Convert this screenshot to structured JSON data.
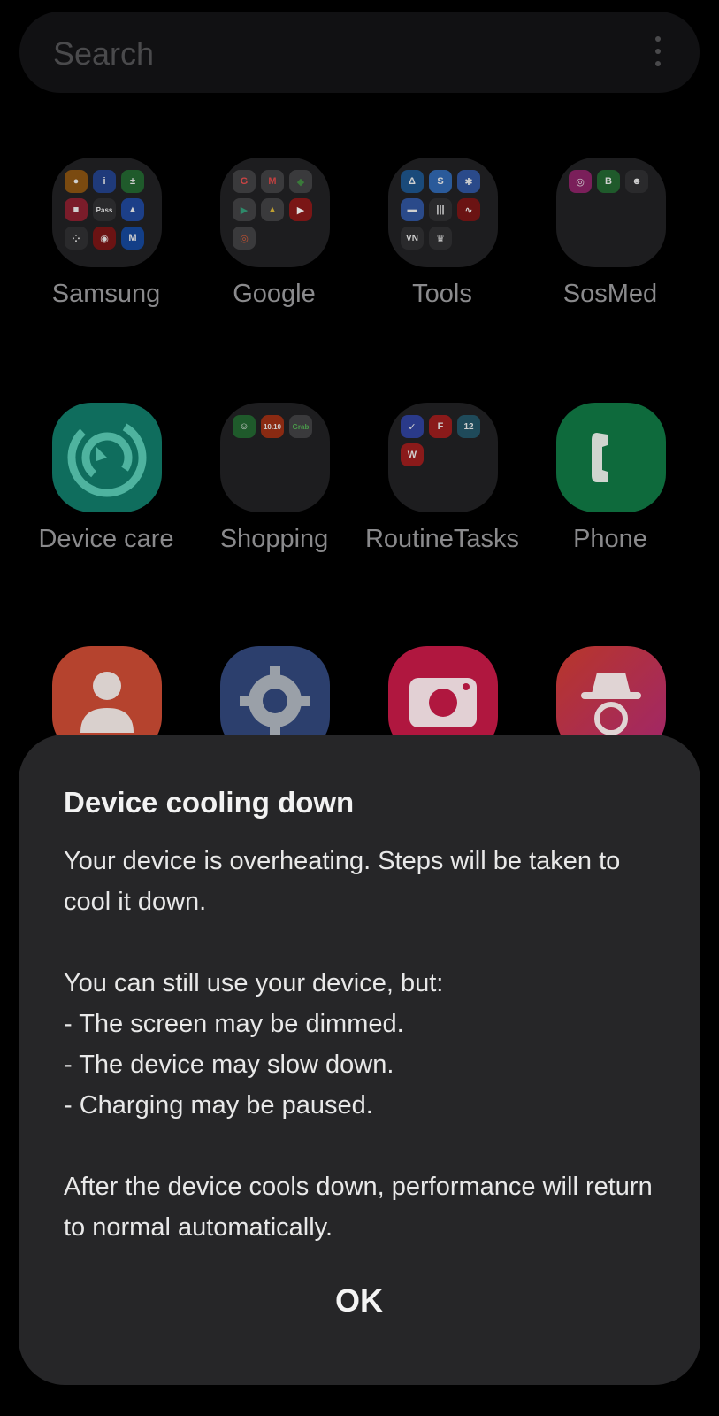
{
  "search": {
    "placeholder": "Search",
    "menu_icon": "more-vertical-icon"
  },
  "apps": [
    {
      "label": "Samsung",
      "type": "folder"
    },
    {
      "label": "Google",
      "type": "folder"
    },
    {
      "label": "Tools",
      "type": "folder"
    },
    {
      "label": "SosMed",
      "type": "folder"
    },
    {
      "label": "Device care",
      "type": "app",
      "icon": "device-care-icon"
    },
    {
      "label": "Shopping",
      "type": "folder"
    },
    {
      "label": "RoutineTasks",
      "type": "folder"
    },
    {
      "label": "Phone",
      "type": "app",
      "icon": "phone-icon"
    },
    {
      "label": "",
      "type": "app",
      "icon": "contacts-icon"
    },
    {
      "label": "",
      "type": "app",
      "icon": "settings-icon"
    },
    {
      "label": "",
      "type": "app",
      "icon": "camera-icon"
    },
    {
      "label": "",
      "type": "app",
      "icon": "incognito-icon"
    }
  ],
  "folder_labels": {
    "pass": "Pass",
    "vn": "VN",
    "date_1010": "10.10",
    "grab": "Grab",
    "cal_12": "12"
  },
  "dialog": {
    "title": "Device cooling down",
    "line1": "Your device is overheating. Steps will be taken to cool it down.",
    "line2": "You can still use your device, but:",
    "bullet1": "- The screen may be dimmed.",
    "bullet2": "- The device may slow down.",
    "bullet3": "- Charging may be paused.",
    "line3": "After the device cools down, performance will return to normal automatically.",
    "ok_label": "OK"
  },
  "colors": {
    "dialog_bg": "#262628",
    "device_care": "#0f6d5d",
    "phone": "#0e6a3c",
    "contacts": "#b5432e",
    "settings": "#2c3f6d",
    "camera": "#b0173f"
  }
}
